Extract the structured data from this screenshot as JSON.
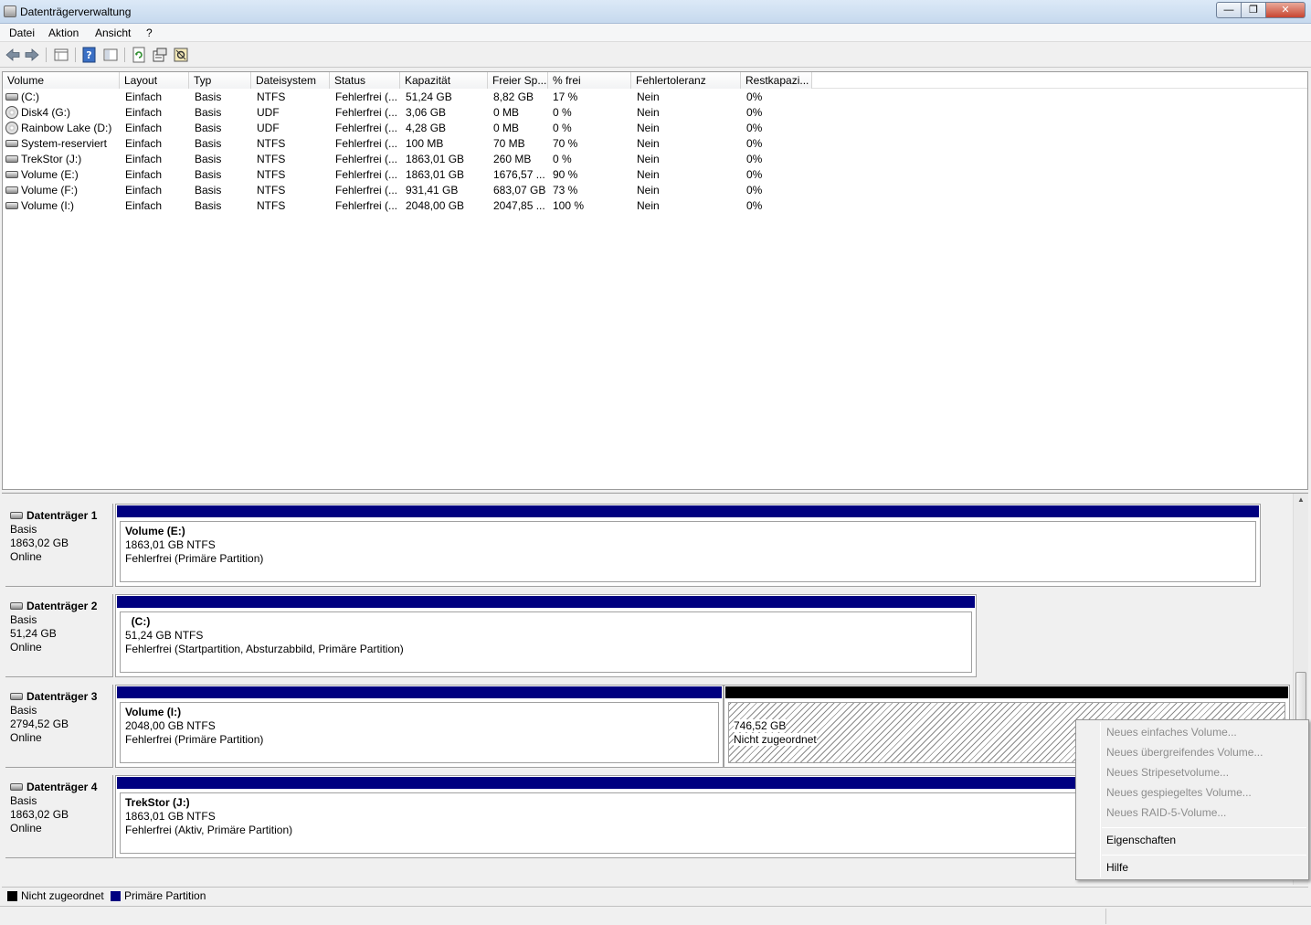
{
  "window": {
    "title": "Datenträgerverwaltung",
    "minimize_glyph": "—",
    "maximize_glyph": "❐",
    "close_glyph": "✕"
  },
  "menu": {
    "datei": "Datei",
    "aktion": "Aktion",
    "ansicht": "Ansicht",
    "hilfe": "?"
  },
  "toolbar_icons": [
    "back-arrow-icon",
    "forward-arrow-icon",
    "list-view-icon",
    "help-icon",
    "panel-icon",
    "refresh-icon",
    "properties-icon",
    "settings-icon"
  ],
  "list": {
    "columns": [
      "Volume",
      "Layout",
      "Typ",
      "Dateisystem",
      "Status",
      "Kapazität",
      "Freier Sp...",
      "% frei",
      "Fehlertoleranz",
      "Restkapazi..."
    ],
    "rows": [
      {
        "volume": " (C:)",
        "layout": "Einfach",
        "typ": "Basis",
        "fs": "NTFS",
        "status": "Fehlerfrei (...",
        "cap": "51,24 GB",
        "free": "8,82 GB",
        "pct": "17 %",
        "fault": "Nein",
        "rest": "0%",
        "icon": "hdd"
      },
      {
        "volume": "Disk4 (G:)",
        "layout": "Einfach",
        "typ": "Basis",
        "fs": "UDF",
        "status": "Fehlerfrei (...",
        "cap": "3,06 GB",
        "free": "0 MB",
        "pct": "0 %",
        "fault": "Nein",
        "rest": "0%",
        "icon": "cd"
      },
      {
        "volume": "Rainbow Lake (D:)",
        "layout": "Einfach",
        "typ": "Basis",
        "fs": "UDF",
        "status": "Fehlerfrei (...",
        "cap": "4,28 GB",
        "free": "0 MB",
        "pct": "0 %",
        "fault": "Nein",
        "rest": "0%",
        "icon": "cd"
      },
      {
        "volume": "System-reserviert",
        "layout": "Einfach",
        "typ": "Basis",
        "fs": "NTFS",
        "status": "Fehlerfrei (...",
        "cap": "100 MB",
        "free": "70 MB",
        "pct": "70 %",
        "fault": "Nein",
        "rest": "0%",
        "icon": "hdd"
      },
      {
        "volume": "TrekStor (J:)",
        "layout": "Einfach",
        "typ": "Basis",
        "fs": "NTFS",
        "status": "Fehlerfrei (...",
        "cap": "1863,01 GB",
        "free": "260 MB",
        "pct": "0 %",
        "fault": "Nein",
        "rest": "0%",
        "icon": "hdd"
      },
      {
        "volume": "Volume (E:)",
        "layout": "Einfach",
        "typ": "Basis",
        "fs": "NTFS",
        "status": "Fehlerfrei (...",
        "cap": "1863,01 GB",
        "free": "1676,57 ...",
        "pct": "90 %",
        "fault": "Nein",
        "rest": "0%",
        "icon": "hdd"
      },
      {
        "volume": "Volume (F:)",
        "layout": "Einfach",
        "typ": "Basis",
        "fs": "NTFS",
        "status": "Fehlerfrei (...",
        "cap": "931,41 GB",
        "free": "683,07 GB",
        "pct": "73 %",
        "fault": "Nein",
        "rest": "0%",
        "icon": "hdd"
      },
      {
        "volume": "Volume (I:)",
        "layout": "Einfach",
        "typ": "Basis",
        "fs": "NTFS",
        "status": "Fehlerfrei (...",
        "cap": "2048,00 GB",
        "free": "2047,85 ...",
        "pct": "100 %",
        "fault": "Nein",
        "rest": "0%",
        "icon": "hdd"
      }
    ]
  },
  "disks": [
    {
      "name": "Datenträger 1",
      "type": "Basis",
      "size": "1863,02 GB",
      "state": "Online",
      "partitions": [
        {
          "kind": "primary",
          "name": "Volume  (E:)",
          "size": "1863,01 GB NTFS",
          "status": "Fehlerfrei (Primäre Partition)"
        }
      ]
    },
    {
      "name": "Datenträger 2",
      "type": "Basis",
      "size": "51,24 GB",
      "state": "Online",
      "partitions": [
        {
          "kind": "primary",
          "name": "  (C:)",
          "size": "51,24 GB NTFS",
          "status": "Fehlerfrei (Startpartition, Absturzabbild, Primäre Partition)"
        }
      ]
    },
    {
      "name": "Datenträger 3",
      "type": "Basis",
      "size": "2794,52 GB",
      "state": "Online",
      "partitions": [
        {
          "kind": "primary",
          "name": "Volume  (I:)",
          "size": "2048,00 GB NTFS",
          "status": "Fehlerfrei (Primäre Partition)"
        },
        {
          "kind": "unalloc",
          "name": "",
          "size": "746,52 GB",
          "status": "Nicht zugeordnet"
        }
      ]
    },
    {
      "name": "Datenträger 4",
      "type": "Basis",
      "size": "1863,02 GB",
      "state": "Online",
      "partitions": [
        {
          "kind": "primary",
          "name": "TrekStor  (J:)",
          "size": "1863,01 GB NTFS",
          "status": "Fehlerfrei (Aktiv, Primäre Partition)"
        }
      ]
    }
  ],
  "legend": {
    "unalloc": "Nicht zugeordnet",
    "primary": "Primäre Partition",
    "unalloc_color": "#000000",
    "primary_color": "#000080"
  },
  "context_menu": {
    "items": [
      {
        "label": "Neues einfaches Volume...",
        "enabled": false
      },
      {
        "label": "Neues übergreifendes Volume...",
        "enabled": false
      },
      {
        "label": "Neues Stripesetvolume...",
        "enabled": false
      },
      {
        "label": "Neues gespiegeltes Volume...",
        "enabled": false
      },
      {
        "label": "Neues RAID-5-Volume...",
        "enabled": false
      },
      {
        "label": "Eigenschaften",
        "enabled": true
      },
      {
        "label": "Hilfe",
        "enabled": true
      }
    ]
  }
}
